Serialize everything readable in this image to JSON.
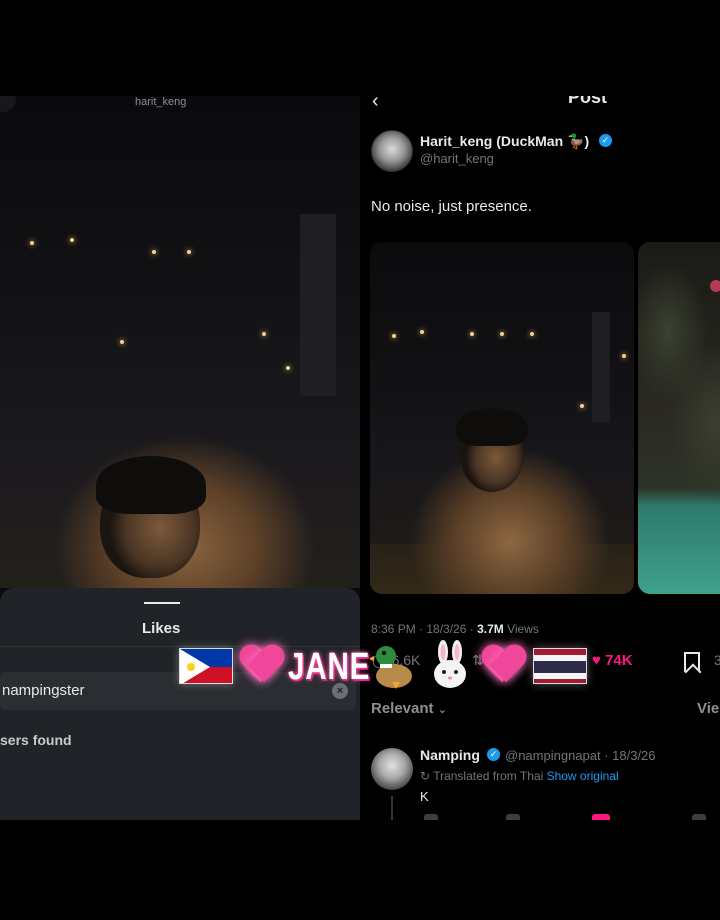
{
  "left": {
    "user_label": "harit_keng",
    "tab_label": "Likes",
    "search_value": "nampingster",
    "empty_state": "sers found"
  },
  "post": {
    "header_title": "Post",
    "author_name": "Harit_keng (DuckMan 🦆)",
    "author_handle": "@harit_keng",
    "text": "No noise, just presence.",
    "time": "8:36 PM · 18/3/26 · ",
    "views_count": "3.7M",
    "views_label": " Views",
    "reply_count": "6.6K",
    "repost_count": "3",
    "like_count": "74K",
    "share_fragment": "3",
    "sort_label": "Relevant",
    "view_fragment": "Vie"
  },
  "reply": {
    "name": "Namping",
    "handle_date": "@nampingnapat · 18/3/26",
    "translated_label": "Translated from Thai",
    "show_original": "Show original",
    "text": "K"
  },
  "overlay": {
    "text": "JANE",
    "icons": [
      "philippines-flag-icon",
      "pink-heart-icon",
      "duck-icon",
      "bunny-icon",
      "pink-heart-icon",
      "thailand-flag-icon"
    ]
  },
  "colors": {
    "background": "#000000",
    "sheet": "#202327",
    "accent_blue": "#1d9bf0",
    "like_pink": "#f91880",
    "muted_text": "#71767b",
    "overlay_glow": "#ff5fb0"
  }
}
